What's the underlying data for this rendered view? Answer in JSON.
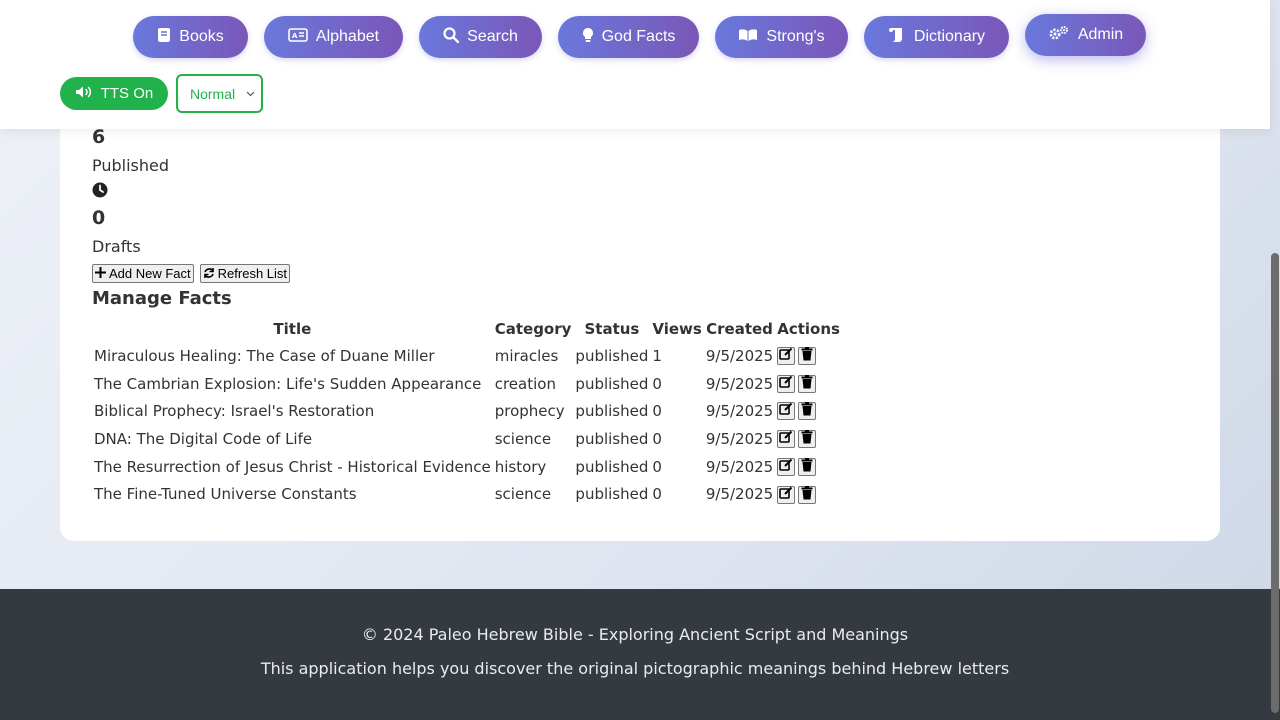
{
  "nav": {
    "books": "Books",
    "alphabet": "Alphabet",
    "search": "Search",
    "god_facts": "God Facts",
    "strongs": "Strong's",
    "dictionary": "Dictionary",
    "admin": "Admin"
  },
  "tts": {
    "label": "TTS On"
  },
  "speed": {
    "selected": "Normal"
  },
  "stats": {
    "total_count": "6",
    "published_count": "6",
    "published_label": "Published",
    "drafts_count": "0",
    "drafts_label": "Drafts"
  },
  "buttons": {
    "add_new_fact": "Add New Fact",
    "refresh_list": "Refresh List"
  },
  "section_title": "Manage Facts",
  "table": {
    "headers": [
      "Title",
      "Category",
      "Status",
      "Views",
      "Created",
      "Actions"
    ],
    "rows": [
      {
        "title": "Miraculous Healing: The Case of Duane Miller",
        "category": "miracles",
        "status": "published",
        "views": "1",
        "created": "9/5/2025"
      },
      {
        "title": "The Cambrian Explosion: Life's Sudden Appearance",
        "category": "creation",
        "status": "published",
        "views": "0",
        "created": "9/5/2025"
      },
      {
        "title": "Biblical Prophecy: Israel's Restoration",
        "category": "prophecy",
        "status": "published",
        "views": "0",
        "created": "9/5/2025"
      },
      {
        "title": "DNA: The Digital Code of Life",
        "category": "science",
        "status": "published",
        "views": "0",
        "created": "9/5/2025"
      },
      {
        "title": "The Resurrection of Jesus Christ - Historical Evidence",
        "category": "history",
        "status": "published",
        "views": "0",
        "created": "9/5/2025"
      },
      {
        "title": "The Fine-Tuned Universe Constants",
        "category": "science",
        "status": "published",
        "views": "0",
        "created": "9/5/2025"
      }
    ]
  },
  "footer": {
    "copyright": "© 2024 Paleo Hebrew Bible - Exploring Ancient Script and Meanings",
    "tagline": "This application helps you discover the original pictographic meanings behind Hebrew letters"
  },
  "colors": {
    "nav_gradient_start": "#6a78dc",
    "nav_gradient_end": "#7a57b8",
    "tts_green": "#22b24c",
    "footer_bg": "#343a40"
  }
}
